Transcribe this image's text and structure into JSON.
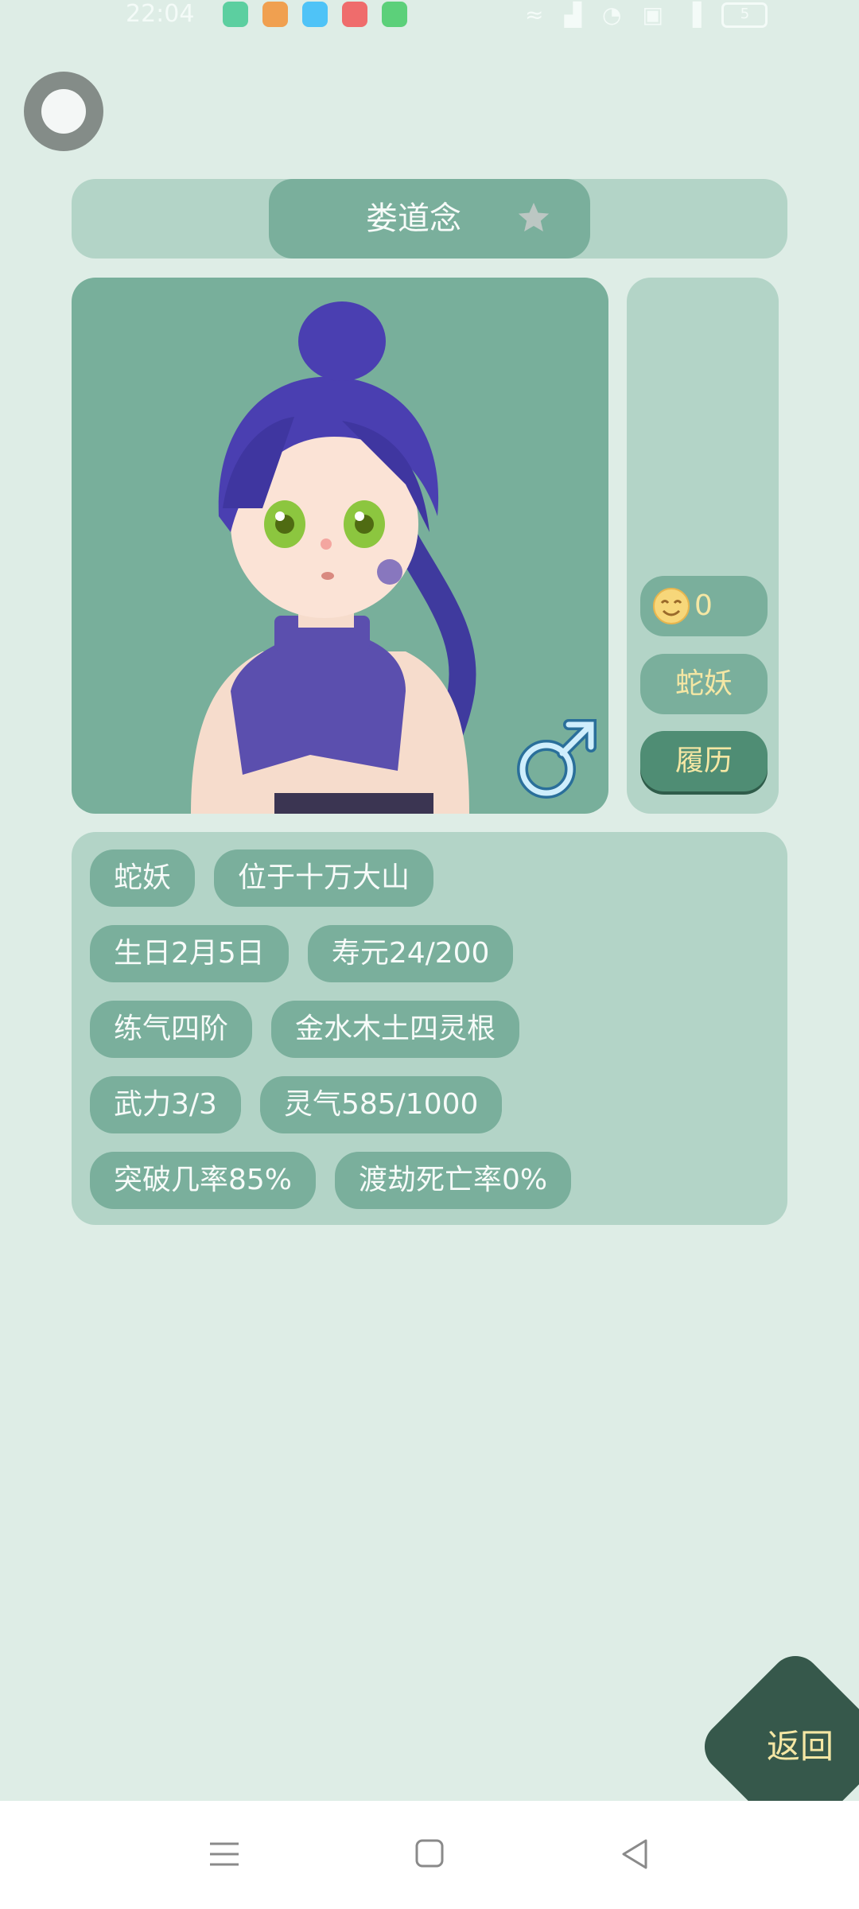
{
  "status_bar": {
    "time": "22:04",
    "battery": "5",
    "app_icon_colors": [
      "#5ccfa0",
      "#f0a050",
      "#4fc3f7",
      "#ef6c6c",
      "#5cd07a"
    ]
  },
  "character": {
    "name": "娄道念",
    "gender_icon": "male-symbol-icon",
    "favorited": false
  },
  "side": {
    "mood_icon": "smiley-face-icon",
    "mood_value": "0",
    "race": "蛇妖",
    "history_label": "履历"
  },
  "info": {
    "rows": [
      [
        "蛇妖",
        "位于十万大山"
      ],
      [
        "生日2月5日",
        "寿元24/200"
      ],
      [
        "练气四阶",
        "金水木土四灵根"
      ],
      [
        "武力3/3",
        "灵气585/1000"
      ],
      [
        "突破几率85%",
        "渡劫死亡率0%"
      ]
    ]
  },
  "back_label": "返回",
  "colors": {
    "background": "#deede6",
    "panel": "#b3d4c7",
    "chip": "#7aaf9c",
    "accent_text": "#f5e7a4",
    "back_button": "#36584b"
  },
  "nav": {
    "icons": [
      "menu-icon",
      "home-square-icon",
      "back-triangle-icon"
    ]
  }
}
